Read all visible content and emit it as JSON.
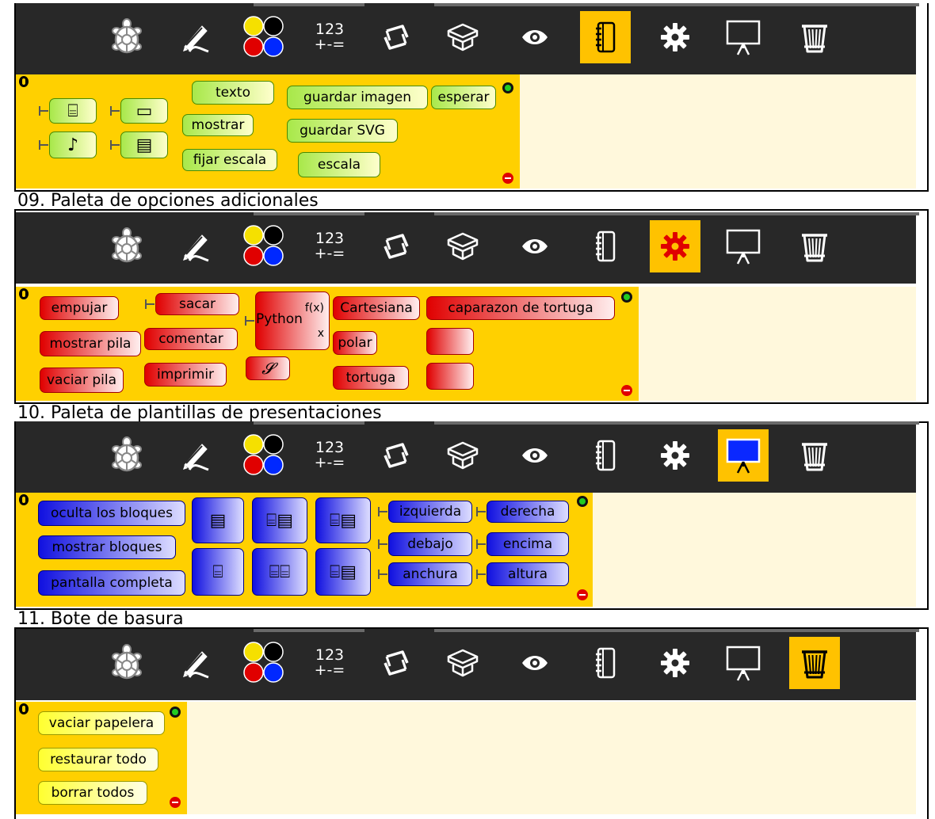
{
  "toolbar": {
    "buttons": [
      {
        "name": "turtle-palette-icon"
      },
      {
        "name": "pen-palette-icon"
      },
      {
        "name": "colors-palette-icon"
      },
      {
        "name": "numbers-palette-icon",
        "line1": "123",
        "line2": "+-="
      },
      {
        "name": "flow-palette-icon"
      },
      {
        "name": "boxes-palette-icon"
      },
      {
        "name": "sensors-palette-icon"
      },
      {
        "name": "media-palette-icon"
      },
      {
        "name": "extras-palette-icon"
      },
      {
        "name": "presentation-palette-icon"
      },
      {
        "name": "trash-palette-icon"
      }
    ],
    "active_color": "#ffc200",
    "bg_color": "#282828"
  },
  "section_media": {
    "blocks": {
      "texto": "texto",
      "mostrar": "mostrar",
      "fijar_escala": "fijar escala",
      "escala": "escala",
      "guardar_imagen": "guardar imagen",
      "guardar_svg": "guardar SVG",
      "esperar": "esperar"
    }
  },
  "captions": {
    "c09": "09. Paleta de opciones adicionales",
    "c10": "10. Paleta de plantillas de presentaciones",
    "c11": "11. Bote de basura"
  },
  "section_extras": {
    "blocks": {
      "empujar": "empujar",
      "mostrar_pila": "mostrar pila",
      "vaciar_pila": "vaciar pila",
      "sacar": "sacar",
      "comentar": "comentar",
      "imprimir": "imprimir",
      "python": "Python",
      "fx": "f(x)",
      "x": "x",
      "cartesiana": "Cartesiana",
      "polar": "polar",
      "tortuga": "tortuga",
      "caparazon": "caparazon de tortuga"
    }
  },
  "section_presentation": {
    "blocks": {
      "oculta": "oculta los bloques",
      "mostrar_bloques": "mostrar bloques",
      "pantalla": "pantalla completa",
      "izquierda": "izquierda",
      "derecha": "derecha",
      "debajo": "debajo",
      "encima": "encima",
      "anchura": "anchura",
      "altura": "altura"
    }
  },
  "section_trash": {
    "blocks": {
      "vaciar": "vaciar papelera",
      "restaurar": "restaurar todo",
      "borrar": "borrar todos"
    }
  },
  "colors": {
    "palette_bg": "#ffd000",
    "workspace_bg": "#fff8dc",
    "media_blocks": "#a8e84a",
    "extras_blocks": "#e00000",
    "presentation_blocks": "#1010e0",
    "trash_blocks": "#ffff30"
  }
}
